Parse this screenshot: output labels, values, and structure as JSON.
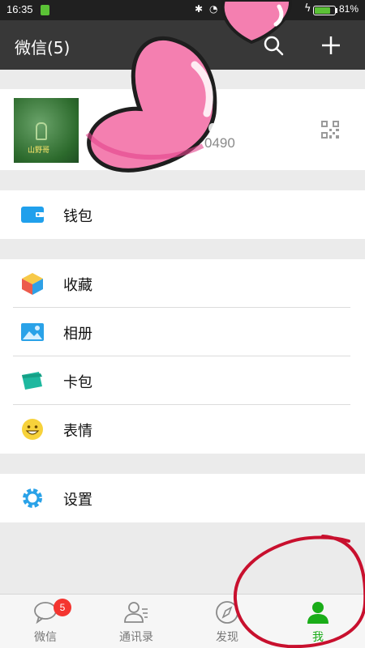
{
  "status_bar": {
    "time": "16:35",
    "battery_percent_label": "81%",
    "battery_level": 0.81,
    "icons": [
      "sim-icon",
      "bluetooth-icon",
      "alarm-icon",
      "charging-icon",
      "battery-icon"
    ]
  },
  "header": {
    "title": "微信(5)",
    "actions": [
      "search-icon",
      "plus-icon"
    ]
  },
  "profile": {
    "avatar_tag": "山野哥",
    "wechat_id_visible": "0490",
    "qr_icon": "qr-code-icon"
  },
  "menu": {
    "wallet": {
      "label": "钱包",
      "icon": "wallet-icon"
    },
    "favorites": {
      "label": "收藏",
      "icon": "cube-icon"
    },
    "album": {
      "label": "相册",
      "icon": "image-icon"
    },
    "cards": {
      "label": "卡包",
      "icon": "card-icon"
    },
    "stickers": {
      "label": "表情",
      "icon": "smiley-icon"
    },
    "settings": {
      "label": "设置",
      "icon": "gear-icon"
    }
  },
  "tabbar": {
    "tabs": [
      {
        "label": "微信",
        "icon": "chat-icon",
        "badge": "5",
        "active": false
      },
      {
        "label": "通讯录",
        "icon": "contacts-icon",
        "active": false
      },
      {
        "label": "发现",
        "icon": "compass-icon",
        "active": false
      },
      {
        "label": "我",
        "icon": "person-icon",
        "active": true
      }
    ]
  },
  "colors": {
    "header_bg": "#383838",
    "accent_green": "#1aad19",
    "badge_red": "#f43530",
    "heart_pink": "#f47fb0",
    "annotation_red": "#c8102e"
  }
}
